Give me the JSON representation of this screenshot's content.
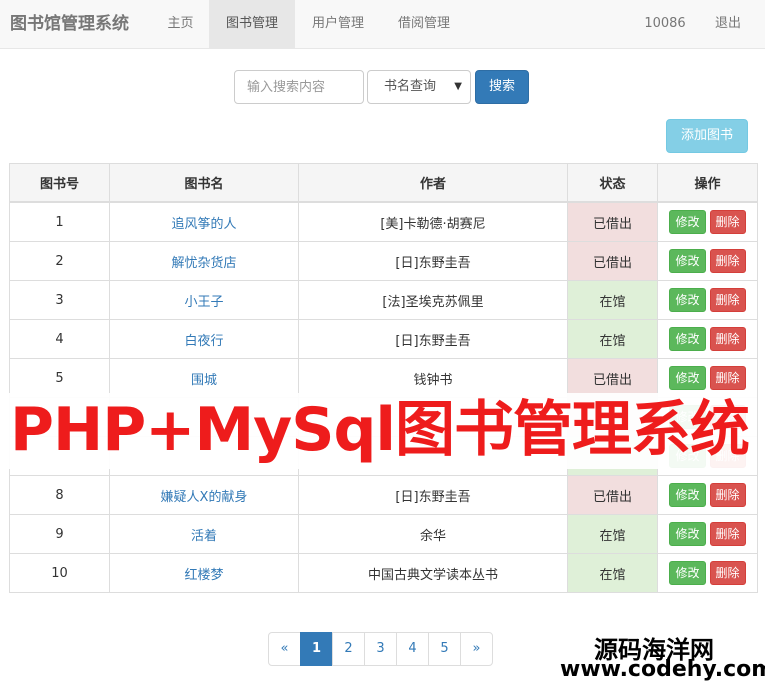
{
  "navbar": {
    "brand": "图书馆管理系统",
    "items": [
      {
        "label": "主页"
      },
      {
        "label": "图书管理",
        "active": true
      },
      {
        "label": "用户管理"
      },
      {
        "label": "借阅管理"
      }
    ],
    "user": "10086",
    "logout": "退出"
  },
  "search": {
    "placeholder": "输入搜索内容",
    "select_value": "书名查询",
    "button": "搜索"
  },
  "add_button": "添加图书",
  "table": {
    "headers": [
      "图书号",
      "图书名",
      "作者",
      "状态",
      "操作"
    ],
    "edit_label": "修改",
    "delete_label": "删除",
    "rows": [
      {
        "id": "1",
        "title": "追风筝的人",
        "author": "[美]卡勒德·胡赛尼",
        "status": "已借出",
        "tone": "danger"
      },
      {
        "id": "2",
        "title": "解忧杂货店",
        "author": "[日]东野圭吾",
        "status": "已借出",
        "tone": "danger"
      },
      {
        "id": "3",
        "title": "小王子",
        "author": "[法]圣埃克苏佩里",
        "status": "在馆",
        "tone": "success"
      },
      {
        "id": "4",
        "title": "白夜行",
        "author": "[日]东野圭吾",
        "status": "在馆",
        "tone": "success"
      },
      {
        "id": "5",
        "title": "围城",
        "author": "钱钟书",
        "status": "已借出",
        "tone": "danger"
      },
      {
        "id": "",
        "title": "",
        "author": "",
        "status": "",
        "tone": "danger"
      },
      {
        "id": "",
        "title": "",
        "author": "",
        "status": "",
        "tone": "success"
      },
      {
        "id": "8",
        "title": "嫌疑人X的献身",
        "author": "[日]东野圭吾",
        "status": "已借出",
        "tone": "danger"
      },
      {
        "id": "9",
        "title": "活着",
        "author": "余华",
        "status": "在馆",
        "tone": "success"
      },
      {
        "id": "10",
        "title": "红楼梦",
        "author": "中国古典文学读本丛书",
        "status": "在馆",
        "tone": "success"
      }
    ]
  },
  "banner": "PHP+MySql图书管理系统",
  "pagination": {
    "prev": "«",
    "pages": [
      "1",
      "2",
      "3",
      "4",
      "5"
    ],
    "active": "1",
    "next": "»"
  },
  "watermark": {
    "name": "源码海洋网",
    "url": "www.codehy.com"
  },
  "colors": {
    "primary": "#337ab7",
    "info": "#5bc0de",
    "success": "#5cb85c",
    "danger": "#d9534f",
    "banner": "#ee1c1c"
  }
}
